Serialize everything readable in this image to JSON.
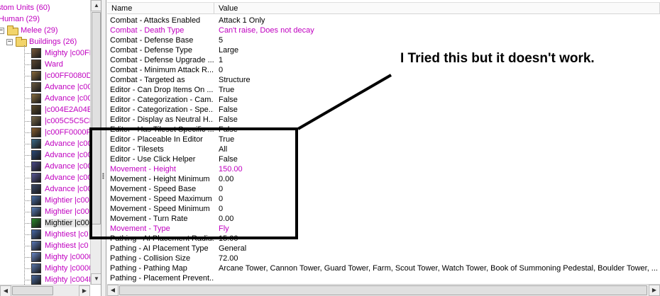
{
  "tree": {
    "items": [
      {
        "label": "stom Units (60)",
        "kind": "root"
      },
      {
        "label": "Human (29)",
        "kind": "race"
      },
      {
        "label": "Melee (29)",
        "kind": "folder"
      },
      {
        "label": "Buildings (26)",
        "kind": "folder"
      },
      {
        "label": "Mighty |c00FF",
        "kind": "unit",
        "color": "#7a5a3a"
      },
      {
        "label": "Ward",
        "kind": "unit",
        "color": "#5a4630"
      },
      {
        "label": "|c00FF0080D",
        "kind": "unit",
        "color": "#8a6a3a"
      },
      {
        "label": "Advance |c00",
        "kind": "unit",
        "color": "#6a5a40"
      },
      {
        "label": "Advance |c00",
        "kind": "unit",
        "color": "#8a7040"
      },
      {
        "label": "|c004E2A04E",
        "kind": "unit",
        "color": "#5a4a2a"
      },
      {
        "label": "|c005C5C5CN",
        "kind": "unit",
        "color": "#7a6a4a"
      },
      {
        "label": "|c00FF0000F",
        "kind": "unit",
        "color": "#8a6030"
      },
      {
        "label": "Advance |c00",
        "kind": "unit",
        "color": "#3a6a8a"
      },
      {
        "label": "Advance |c00",
        "kind": "unit",
        "color": "#2a4a7a"
      },
      {
        "label": "Advance |c00",
        "kind": "unit",
        "color": "#4a4a8a"
      },
      {
        "label": "Advance |c00",
        "kind": "unit",
        "color": "#5a5a9a"
      },
      {
        "label": "Advance |c00",
        "kind": "unit",
        "color": "#3a4a6a"
      },
      {
        "label": "Mightier |c00",
        "kind": "unit",
        "color": "#4a70aa"
      },
      {
        "label": "Mightier |c00",
        "kind": "unit",
        "color": "#5a80ba"
      },
      {
        "label": "Mightier |c00",
        "kind": "unit",
        "color": "#2a8a2a",
        "selected": true
      },
      {
        "label": "Mightiest |c0",
        "kind": "unit",
        "color": "#4a6aaa"
      },
      {
        "label": "Mightiest |c0",
        "kind": "unit",
        "color": "#5a7aba"
      },
      {
        "label": "Mighty |c0000",
        "kind": "unit",
        "color": "#6a8aca"
      },
      {
        "label": "Mighty |c0000",
        "kind": "unit",
        "color": "#5a7ab0"
      },
      {
        "label": "Mighty |c004F",
        "kind": "unit",
        "color": "#4a6aa0"
      }
    ]
  },
  "list": {
    "columns": {
      "name": "Name",
      "value": "Value"
    },
    "rows": [
      {
        "name": "Combat - Attacks Enabled",
        "value": "Attack 1 Only",
        "modified": false
      },
      {
        "name": "Combat - Death Type",
        "value": "Can't raise, Does not decay",
        "modified": true
      },
      {
        "name": "Combat - Defense Base",
        "value": "5",
        "modified": false
      },
      {
        "name": "Combat - Defense Type",
        "value": "Large",
        "modified": false
      },
      {
        "name": "Combat - Defense Upgrade ...",
        "value": "1",
        "modified": false
      },
      {
        "name": "Combat - Minimum Attack R...",
        "value": "0",
        "modified": false
      },
      {
        "name": "Combat - Targeted as",
        "value": "Structure",
        "modified": false
      },
      {
        "name": "Editor - Can Drop Items On ...",
        "value": "True",
        "modified": false
      },
      {
        "name": "Editor - Categorization - Cam...",
        "value": "False",
        "modified": false
      },
      {
        "name": "Editor - Categorization - Spe...",
        "value": "False",
        "modified": false
      },
      {
        "name": "Editor - Display as Neutral H...",
        "value": "False",
        "modified": false
      },
      {
        "name": "Editor - Has Tileset Specific ...",
        "value": "False",
        "modified": false
      },
      {
        "name": "Editor - Placeable In Editor",
        "value": "True",
        "modified": false
      },
      {
        "name": "Editor - Tilesets",
        "value": "All",
        "modified": false
      },
      {
        "name": "Editor - Use Click Helper",
        "value": "False",
        "modified": false
      },
      {
        "name": "Movement - Height",
        "value": "150.00",
        "modified": true
      },
      {
        "name": "Movement - Height Minimum",
        "value": "0.00",
        "modified": false
      },
      {
        "name": "Movement - Speed Base",
        "value": "0",
        "modified": false
      },
      {
        "name": "Movement - Speed Maximum",
        "value": "0",
        "modified": false
      },
      {
        "name": "Movement - Speed Minimum",
        "value": "0",
        "modified": false
      },
      {
        "name": "Movement - Turn Rate",
        "value": "0.00",
        "modified": false
      },
      {
        "name": "Movement - Type",
        "value": "Fly",
        "modified": true
      },
      {
        "name": "Pathing - AI Placement Radius",
        "value": "15.00",
        "modified": false
      },
      {
        "name": "Pathing - AI Placement Type",
        "value": "General",
        "modified": false
      },
      {
        "name": "Pathing - Collision Size",
        "value": "72.00",
        "modified": false
      },
      {
        "name": "Pathing - Pathing Map",
        "value": "Arcane Tower, Cannon Tower, Guard Tower, Farm, Scout Tower, Watch Tower, Book of Summoning Pedestal, Boulder Tower, ...",
        "modified": false
      },
      {
        "name": "Pathing - Placement Prevent...",
        "value": "",
        "modified": false
      }
    ]
  },
  "annotation": {
    "text": "I Tried this but it doesn't work."
  },
  "colors": {
    "modified_text": "#c000c0",
    "annotation": "#000000"
  }
}
